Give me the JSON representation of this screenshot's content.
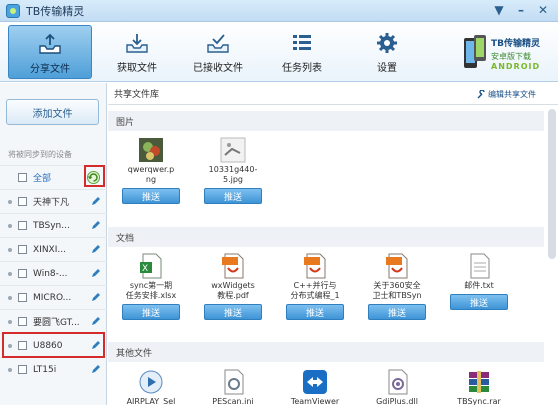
{
  "app": {
    "title": "TB传输精灵"
  },
  "window": {
    "menu_symbol": "▼",
    "minimize_symbol": "–",
    "close_symbol": "✕"
  },
  "toolbar": {
    "items": [
      {
        "label": "分享文件",
        "icon": "share-tray-icon",
        "active": true
      },
      {
        "label": "获取文件",
        "icon": "receive-tray-icon",
        "active": false
      },
      {
        "label": "已接收文件",
        "icon": "received-check-icon",
        "active": false
      },
      {
        "label": "任务列表",
        "icon": "task-list-icon",
        "active": false
      },
      {
        "label": "设置",
        "icon": "gear-icon",
        "active": false
      }
    ],
    "brand": {
      "title": "TB传输精灵",
      "sub": "安卓版下载",
      "platform": "ANDROID"
    }
  },
  "sidebar": {
    "add_button": "添加文件",
    "sync_label": "将被同步到的设备",
    "all_label": "全部",
    "devices": [
      {
        "name": "天神下凡"
      },
      {
        "name": "TBSyn..."
      },
      {
        "name": "XINXI..."
      },
      {
        "name": "Win8-..."
      },
      {
        "name": "MICRO..."
      },
      {
        "name": "要圆飞GT..."
      },
      {
        "name": "U8860"
      },
      {
        "name": "LT15i"
      }
    ]
  },
  "library": {
    "title": "共享文件库",
    "edit_link": "编辑共享文件",
    "push_label": "推送",
    "sections": [
      {
        "title": "图片",
        "files": [
          {
            "name_l1": "qwerqwer.p",
            "name_l2": "ng",
            "icon": "image-thumb-icon"
          },
          {
            "name_l1": "10331g440-",
            "name_l2": "5.jpg",
            "icon": "image-thumb-icon"
          }
        ]
      },
      {
        "title": "文档",
        "files": [
          {
            "name_l1": "sync第一期",
            "name_l2": "任务安排.xlsx",
            "icon": "excel-file-icon"
          },
          {
            "name_l1": "wxWidgets",
            "name_l2": "教程.pdf",
            "icon": "pdf-file-icon"
          },
          {
            "name_l1": "C++并行与",
            "name_l2": "分布式编程_1",
            "icon": "pdf-file-icon"
          },
          {
            "name_l1": "关于360安全",
            "name_l2": "卫士和TBSyn",
            "icon": "pdf-file-icon"
          },
          {
            "name_l1": "邮件.txt",
            "name_l2": "",
            "icon": "text-file-icon"
          }
        ]
      },
      {
        "title": "其他文件",
        "files": [
          {
            "name_l1": "AIRPLAY_Sel",
            "icon": "media-file-icon"
          },
          {
            "name_l1": "PEScan.ini",
            "icon": "ini-file-icon"
          },
          {
            "name_l1": "TeamViewer",
            "icon": "teamviewer-icon"
          },
          {
            "name_l1": "GdiPlus.dll",
            "icon": "dll-file-icon"
          },
          {
            "name_l1": "TBSync.rar",
            "icon": "rar-file-icon"
          }
        ]
      }
    ]
  },
  "colors": {
    "accent": "#3e94d6",
    "highlight": "#d42b2b"
  }
}
